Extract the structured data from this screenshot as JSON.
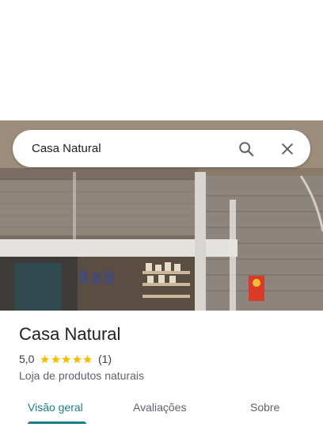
{
  "search": {
    "query": "Casa Natural"
  },
  "place": {
    "name": "Casa Natural",
    "rating": "5,0",
    "stars": 5,
    "review_count": "(1)",
    "category": "Loja de produtos naturais"
  },
  "tabs": [
    {
      "label": "Visão geral",
      "active": true
    },
    {
      "label": "Avaliações",
      "active": false
    },
    {
      "label": "Sobre",
      "active": false
    }
  ],
  "colors": {
    "accent": "#1a7f8a",
    "star": "#fbbc04"
  },
  "icons": [
    "search-icon",
    "close-icon",
    "star-icon"
  ]
}
